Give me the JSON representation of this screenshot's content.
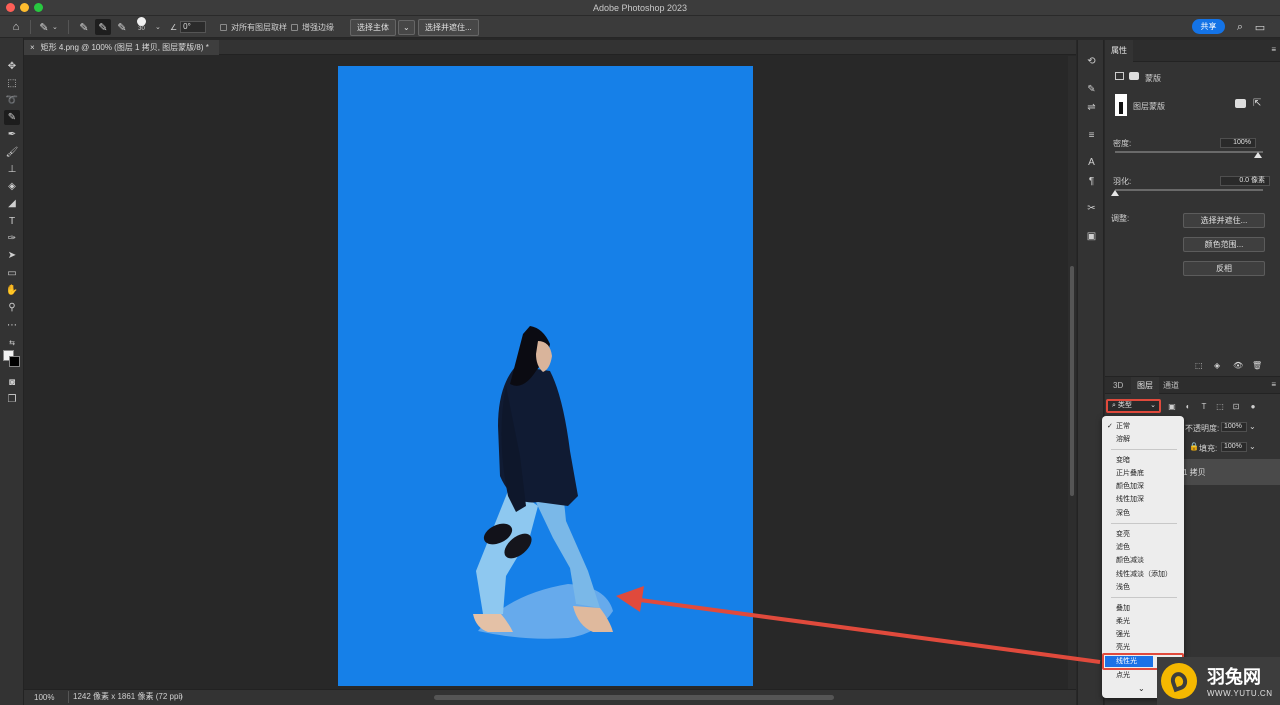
{
  "app": {
    "title": "Adobe Photoshop 2023"
  },
  "colors": {
    "canvas_blue": "#1680e8",
    "accent": "#1473e6",
    "annotation_red": "#e04a3c"
  },
  "options_bar": {
    "brush_size": "30",
    "angle_value": "0°",
    "sample_all_layers_label": "对所有图层取样",
    "enhance_edge_label": "增强边缘",
    "select_subject_label": "选择主体",
    "select_and_mask_label": "选择并遮住...",
    "share_label": "共享"
  },
  "document": {
    "tab_title": "矩形 4.png @ 100% (图层 1 拷贝, 图层蒙版/8) *",
    "zoom": "100%",
    "size_info": "1242 像素 x 1861 像素 (72 ppi)"
  },
  "properties": {
    "tab_label": "属性",
    "mask_type_label": "蒙版",
    "layer_mask_label": "图层蒙版",
    "density_label": "密度:",
    "density_value": "100%",
    "feather_label": "羽化:",
    "feather_value": "0.0 像素",
    "adjust_label": "调整:",
    "buttons": [
      "选择并遮住...",
      "颜色范围...",
      "反相"
    ]
  },
  "layers_panel": {
    "tabs": [
      "3D",
      "图层",
      "通道"
    ],
    "filter_label": "类型",
    "opacity_label": "不透明度:",
    "opacity_value": "100%",
    "fill_label": "填充:",
    "fill_value": "100%",
    "layer_name": "1 拷贝"
  },
  "blend_menu": {
    "groups": [
      [
        "正常",
        "溶解"
      ],
      [
        "变暗",
        "正片叠底",
        "颜色加深",
        "线性加深",
        "深色"
      ],
      [
        "变亮",
        "滤色",
        "颜色减淡",
        "线性减淡（添加）",
        "浅色"
      ],
      [
        "叠加",
        "柔光",
        "强光",
        "亮光",
        "线性光",
        "点光"
      ]
    ],
    "checked": "正常",
    "highlighted": "线性光"
  },
  "watermark": {
    "title": "羽兔网",
    "url": "WWW.YUTU.CN"
  }
}
